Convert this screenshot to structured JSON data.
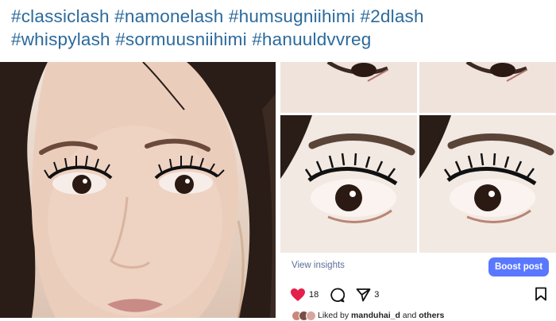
{
  "caption": {
    "line1": "#classiclash #namonelash #humsugniihimi #2dlash",
    "line2": "#whispylash #sormuusniihimi #hanuuldvvreg"
  },
  "post_actions": {
    "view_insights": "View insights",
    "boost_post": "Boost post",
    "like_count": "18",
    "share_count": "3",
    "liked_by_prefix": "Liked by",
    "liked_by_user": "manduhai_d",
    "liked_by_suffix": "and",
    "liked_by_others": "others"
  },
  "icons": [
    "heart-icon",
    "comment-icon",
    "share-icon",
    "bookmark-icon"
  ],
  "colors": {
    "hashtag": "#2b6a9c",
    "boost": "#5a78ff",
    "heart": "#e3204a",
    "insights": "#5b6f99"
  }
}
